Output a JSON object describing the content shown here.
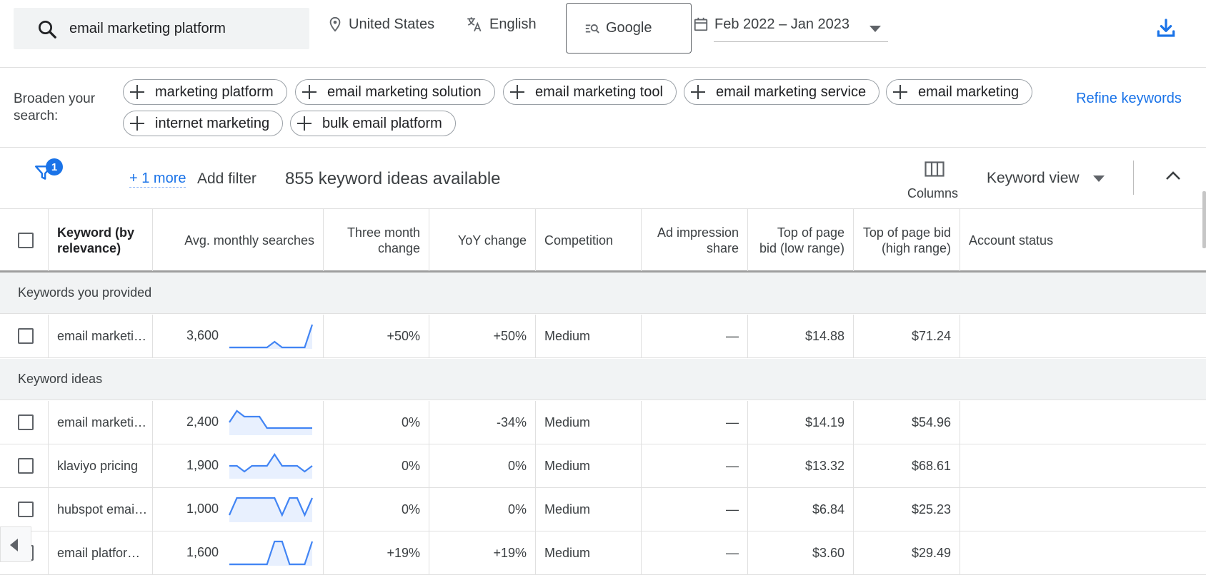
{
  "topbar": {
    "search_value": "email marketing platform",
    "location": "United States",
    "language": "English",
    "network": "Google",
    "date_range": "Feb 2022 – Jan 2023"
  },
  "broaden": {
    "label": "Broaden your search:",
    "pills": [
      "marketing platform",
      "email marketing solution",
      "email marketing tool",
      "email marketing service",
      "email marketing",
      "internet marketing",
      "bulk email platform"
    ],
    "refine_label": "Refine keywords"
  },
  "filterbar": {
    "badge_count": "1",
    "more_label": "+ 1 more",
    "add_filter_label": "Add filter",
    "ideas_count": "855 keyword ideas available",
    "columns_label": "Columns",
    "view_label": "Keyword view"
  },
  "table": {
    "headers": {
      "keyword": "Keyword (by relevance)",
      "avg": "Avg. monthly searches",
      "three_month": "Three month change",
      "yoy": "YoY change",
      "competition": "Competition",
      "ad_share": "Ad impression share",
      "bid_low": "Top of page bid (low range)",
      "bid_high": "Top of page bid (high range)",
      "account": "Account status"
    },
    "sections": {
      "provided": "Keywords you provided",
      "ideas": "Keyword ideas"
    },
    "provided_rows": [
      {
        "keyword": "email marketi…",
        "avg": "3,600",
        "three_month": "+50%",
        "yoy": "+50%",
        "competition": "Medium",
        "ad_share": "—",
        "bid_low": "$14.88",
        "bid_high": "$71.24",
        "trend": [
          1,
          1,
          1,
          1,
          1,
          1,
          2,
          1,
          1,
          1,
          1,
          5
        ]
      }
    ],
    "idea_rows": [
      {
        "keyword": "email marketi…",
        "avg": "2,400",
        "three_month": "0%",
        "yoy": "-34%",
        "competition": "Medium",
        "ad_share": "—",
        "bid_low": "$14.19",
        "bid_high": "$54.96",
        "trend": [
          3,
          5,
          4,
          4,
          4,
          2,
          2,
          2,
          2,
          2,
          2,
          2
        ]
      },
      {
        "keyword": "klaviyo pricing",
        "avg": "1,900",
        "three_month": "0%",
        "yoy": "0%",
        "competition": "Medium",
        "ad_share": "—",
        "bid_low": "$13.32",
        "bid_high": "$68.61",
        "trend": [
          3,
          3,
          2,
          3,
          3,
          3,
          5,
          3,
          3,
          3,
          2,
          3
        ]
      },
      {
        "keyword": "hubspot emai…",
        "avg": "1,000",
        "three_month": "0%",
        "yoy": "0%",
        "competition": "Medium",
        "ad_share": "—",
        "bid_low": "$6.84",
        "bid_high": "$25.23",
        "trend": [
          2,
          5,
          5,
          5,
          5,
          5,
          5,
          2,
          5,
          5,
          2,
          5
        ]
      },
      {
        "keyword": "email platfor…",
        "avg": "1,600",
        "three_month": "+19%",
        "yoy": "+19%",
        "competition": "Medium",
        "ad_share": "—",
        "bid_low": "$3.60",
        "bid_high": "$29.49",
        "trend": [
          1,
          1,
          1,
          1,
          1,
          1,
          5,
          5,
          1,
          1,
          1,
          5
        ]
      }
    ]
  },
  "colors": {
    "accent": "#1a73e8",
    "spark_line": "#4285f4",
    "spark_fill": "#e8f0fe"
  }
}
